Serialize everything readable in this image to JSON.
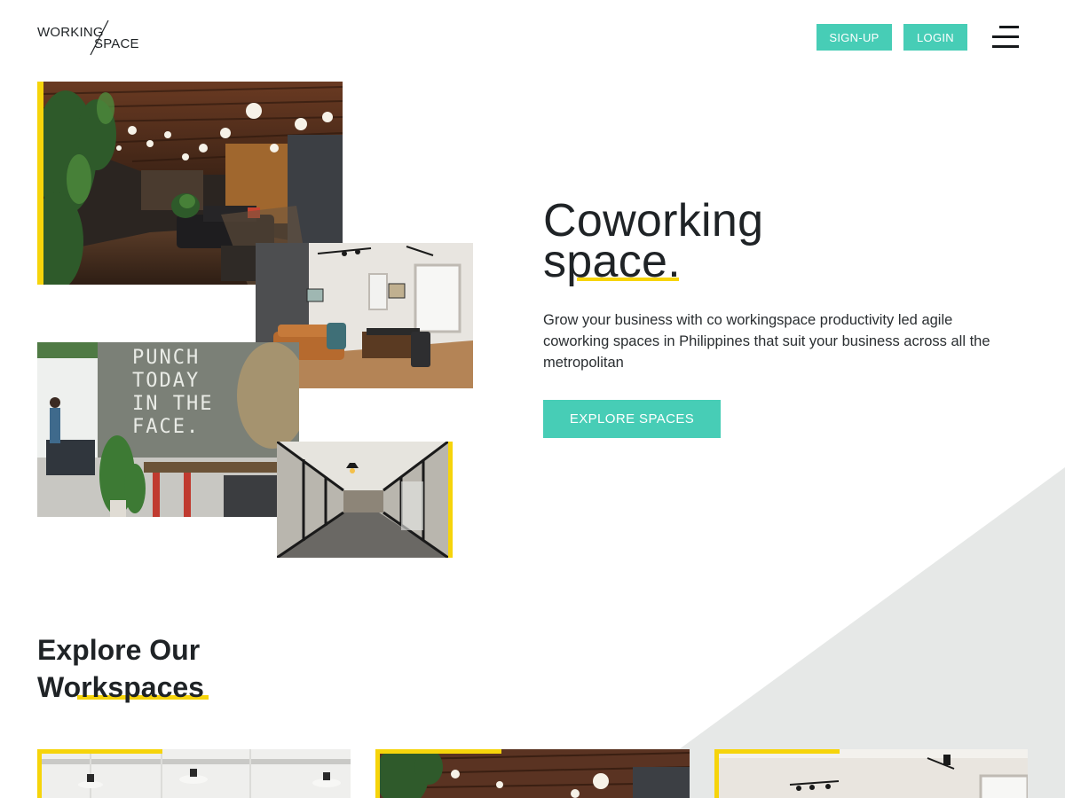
{
  "brand": {
    "logo_line1": "WORKING",
    "logo_line2": "SPACE"
  },
  "header": {
    "signup_label": "SIGN-UP",
    "login_label": "LOGIN",
    "menu_icon": "hamburger-menu-icon"
  },
  "hero": {
    "title_line1": "Coworking",
    "title_line2": "space.",
    "description": "Grow your business with co workingspace productivity led agile coworking spaces in Philippines that suit your business across all the metropolitan",
    "cta_label": "EXPLORE SPACES",
    "photo_text": "PUNCH TODAY IN THE FACE."
  },
  "section": {
    "title_line1": "Explore Our",
    "title_line2": "Workspaces"
  },
  "colors": {
    "accent_teal": "#47cdb6",
    "accent_yellow": "#f6d40b",
    "background_shape": "#e6e8e7",
    "text_dark": "#1f2326"
  }
}
